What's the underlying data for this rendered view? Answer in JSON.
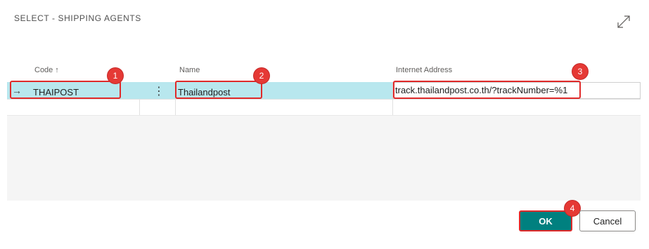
{
  "dialog": {
    "title": "SELECT - SHIPPING AGENTS",
    "expand_icon": "expand-diagonal-icon"
  },
  "columns": {
    "code": "Code",
    "code_sort": "↑",
    "name": "Name",
    "internet_address": "Internet Address"
  },
  "rows": [
    {
      "indicator": "→",
      "code": "THAIPOST",
      "menu": "⋮",
      "name": "Thailandpost",
      "internet_address": "track.thailandpost.co.th/?trackNumber=%1"
    }
  ],
  "callouts": [
    "1",
    "2",
    "3",
    "4"
  ],
  "buttons": {
    "ok": "OK",
    "cancel": "Cancel"
  },
  "colors": {
    "selected_row": "#b8e7ee",
    "ok_button": "#00807f",
    "callout": "#e53935"
  }
}
